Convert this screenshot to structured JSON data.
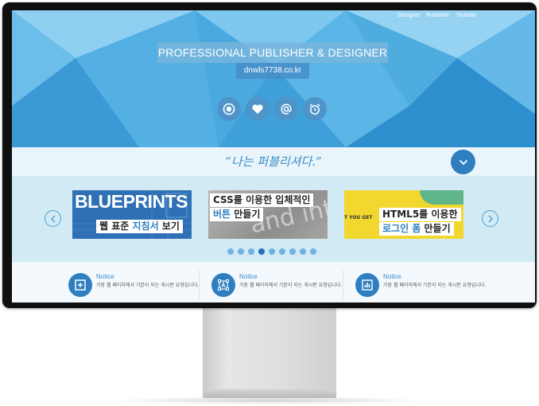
{
  "nav": [
    "Designer",
    "Publisher",
    "Youtube"
  ],
  "hero": {
    "title": "PROFESSIONAL PUBLISHER & DESIGNER",
    "domain": "dnwls7738.co.kr",
    "icons": [
      "target-icon",
      "heart-icon",
      "at-icon",
      "alarm-clock-icon"
    ]
  },
  "slogan": "“나는 퍼블리셔다.”",
  "slider": {
    "cards": [
      {
        "banner": "BLUEPRINTS",
        "line1": "웹 표준 ",
        "hl1": "지침서",
        "line1b": " 보기"
      },
      {
        "bgtext": "and inte",
        "line1": "CSS를 이용한 입체적인",
        "hl2": "버튼",
        "line2b": " 만들기"
      },
      {
        "bgtext": "T YOU GET",
        "line1": "HTML5를 이용한",
        "hl2": "로그인 폼",
        "line2b": " 만들기"
      }
    ],
    "dot_count": 9,
    "active_dot": 3
  },
  "notices": [
    {
      "title": "Notice",
      "desc": "가장 웹 페이지에서 기본이 되는 게시판 유형입니다.",
      "icon": "plus-square-icon"
    },
    {
      "title": "Notice",
      "desc": "가장 웹 페이지에서 기본이 되는 게시판 유형입니다.",
      "icon": "vector-shape-icon"
    },
    {
      "title": "Notice",
      "desc": "가장 웹 페이지에서 기본이 되는 게시판 유형입니다.",
      "icon": "bar-chart-icon"
    }
  ],
  "colors": {
    "accent": "#2f7fc0",
    "light": "#e9f5fb",
    "slider_bg": "#d1eaf4"
  }
}
